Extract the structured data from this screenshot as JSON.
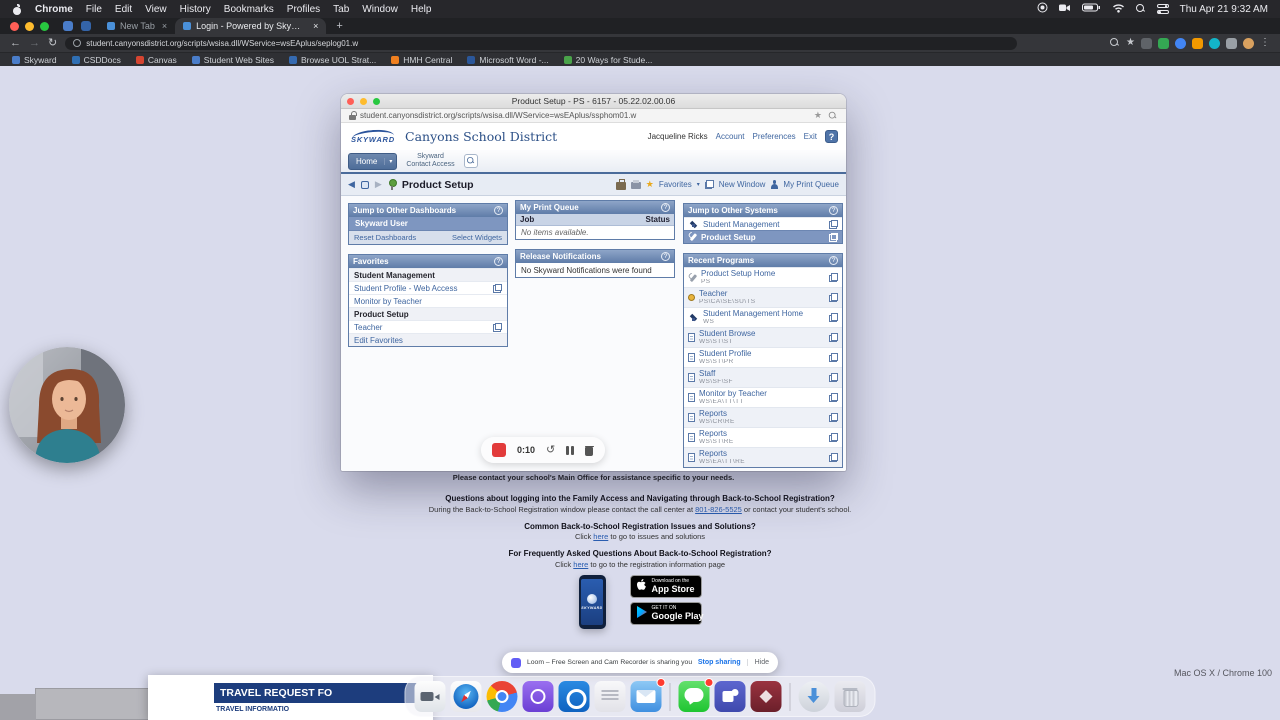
{
  "icons": {
    "help": "?",
    "star": "★",
    "back": "◀",
    "forward": "▶",
    "dropdown": "▾",
    "close": "×",
    "add": "+",
    "undo": "↺",
    "menu": "⋮",
    "arrow_back": "←",
    "arrow_forward": "→",
    "reload": "↻"
  },
  "colors": {
    "page_bg": "#d9dbec",
    "panel_header": "#5f7ca8",
    "selected_row": "#7e96c0",
    "link_blue": "#3f66a0",
    "record_red": "#e23b3b",
    "loom_purple": "#625df5"
  },
  "menubar": {
    "items": [
      "Chrome",
      "File",
      "Edit",
      "View",
      "History",
      "Bookmarks",
      "Profiles",
      "Tab",
      "Window",
      "Help"
    ],
    "clock": "Thu Apr 21 9:32 AM"
  },
  "browser": {
    "tabs": [
      {
        "label": "New Tab"
      },
      {
        "label": "Login - Powered by Skyward"
      }
    ],
    "url": "student.canyonsdistrict.org/scripts/wsisa.dll/WService=wsEAplus/seplog01.w",
    "bookmarks": [
      "Skyward",
      "CSDDocs",
      "Canvas",
      "Student Web Sites",
      "Browse UOL Strat...",
      "HMH Central",
      "Microsoft Word -...",
      "20 Ways for Stude..."
    ]
  },
  "popup": {
    "title": "Product Setup - PS - 6157 - 05.22.02.00.06",
    "url": "student.canyonsdistrict.org/scripts/wsisa.dll/WService=wsEAplus/ssphom01.w",
    "header": {
      "brand": "SKYWARD",
      "district": "Canyons School District",
      "user": "Jacqueline Ricks",
      "account": "Account",
      "preferences": "Preferences",
      "exit": "Exit"
    },
    "nav": {
      "home": "Home",
      "app_line1": "Skyward",
      "app_line2": "Contact Access"
    },
    "toolbar": {
      "title": "Product Setup",
      "favorites": "Favorites",
      "new_window": "New Window",
      "print_queue": "My Print Queue"
    },
    "dashboards": {
      "title": "Jump to Other Dashboards",
      "selected": "Skyward User",
      "reset": "Reset Dashboards",
      "widgets": "Select Widgets"
    },
    "favorites": {
      "title": "Favorites",
      "items": [
        {
          "label": "Student Management"
        },
        {
          "label": "Student Profile - Web Access"
        },
        {
          "label": "Monitor by Teacher"
        },
        {
          "label": "Product Setup"
        },
        {
          "label": "Teacher"
        },
        {
          "label": "Edit Favorites"
        }
      ]
    },
    "print_queue": {
      "title": "My Print Queue",
      "col_job": "Job",
      "col_status": "Status",
      "empty": "No items available."
    },
    "notifications": {
      "title": "Release Notifications",
      "empty": "No Skyward Notifications were found"
    },
    "systems": {
      "title": "Jump to Other Systems",
      "items": [
        {
          "label": "Student Management"
        },
        {
          "label": "Product Setup"
        }
      ]
    },
    "recent": {
      "title": "Recent Programs",
      "items": [
        {
          "label": "Product Setup Home",
          "code": "PS"
        },
        {
          "label": "Teacher",
          "code": "PS\\CA\\SE\\SU\\TS"
        },
        {
          "label": "Student Management Home",
          "code": "WS"
        },
        {
          "label": "Student Browse",
          "code": "WS\\ST\\ST"
        },
        {
          "label": "Student Profile",
          "code": "WS\\ST\\PR"
        },
        {
          "label": "Staff",
          "code": "WS\\SF\\SF"
        },
        {
          "label": "Monitor by Teacher",
          "code": "WS\\EA\\TT\\TT"
        },
        {
          "label": "Reports",
          "code": "WS\\CR\\RE"
        },
        {
          "label": "Reports",
          "code": "WS\\ST\\RE"
        },
        {
          "label": "Reports",
          "code": "WS\\EA\\TT\\RE"
        }
      ]
    }
  },
  "page": {
    "note": "Please contact your school's Main Office for assistance specific to your needs.",
    "q1": "Questions about logging into the Family Access and Navigating through Back-to-School Registration?",
    "a1_pre": "During the Back-to-School Registration window please contact the call center at ",
    "a1_link": "801-826-5525",
    "a1_post": " or contact your student's school.",
    "q2": "Common Back-to-School Registration Issues and Solutions?",
    "a2_pre": "Click ",
    "a2_link": "here",
    "a2_post": " to go to issues and solutions",
    "q3": "For Frequently Asked Questions About Back-to-School Registration?",
    "a3_pre": "Click ",
    "a3_link": "here",
    "a3_post": " to go to the registration information page",
    "divider": "-",
    "appstore_top": "Download on the",
    "appstore_bottom": "App Store",
    "play_top": "GET IT ON",
    "play_bottom": "Google Play",
    "phone_brand": "SKYWARD"
  },
  "loom": {
    "timer": "0:10",
    "message": "Loom – Free Screen and Cam Recorder is sharing your screen.",
    "stop": "Stop sharing",
    "hide": "Hide"
  },
  "background_window": {
    "line1": "TRAVEL REQUEST FO",
    "line2": "TRAVEL INFORMATIO"
  },
  "os_note": "Mac OS X / Chrome 100"
}
